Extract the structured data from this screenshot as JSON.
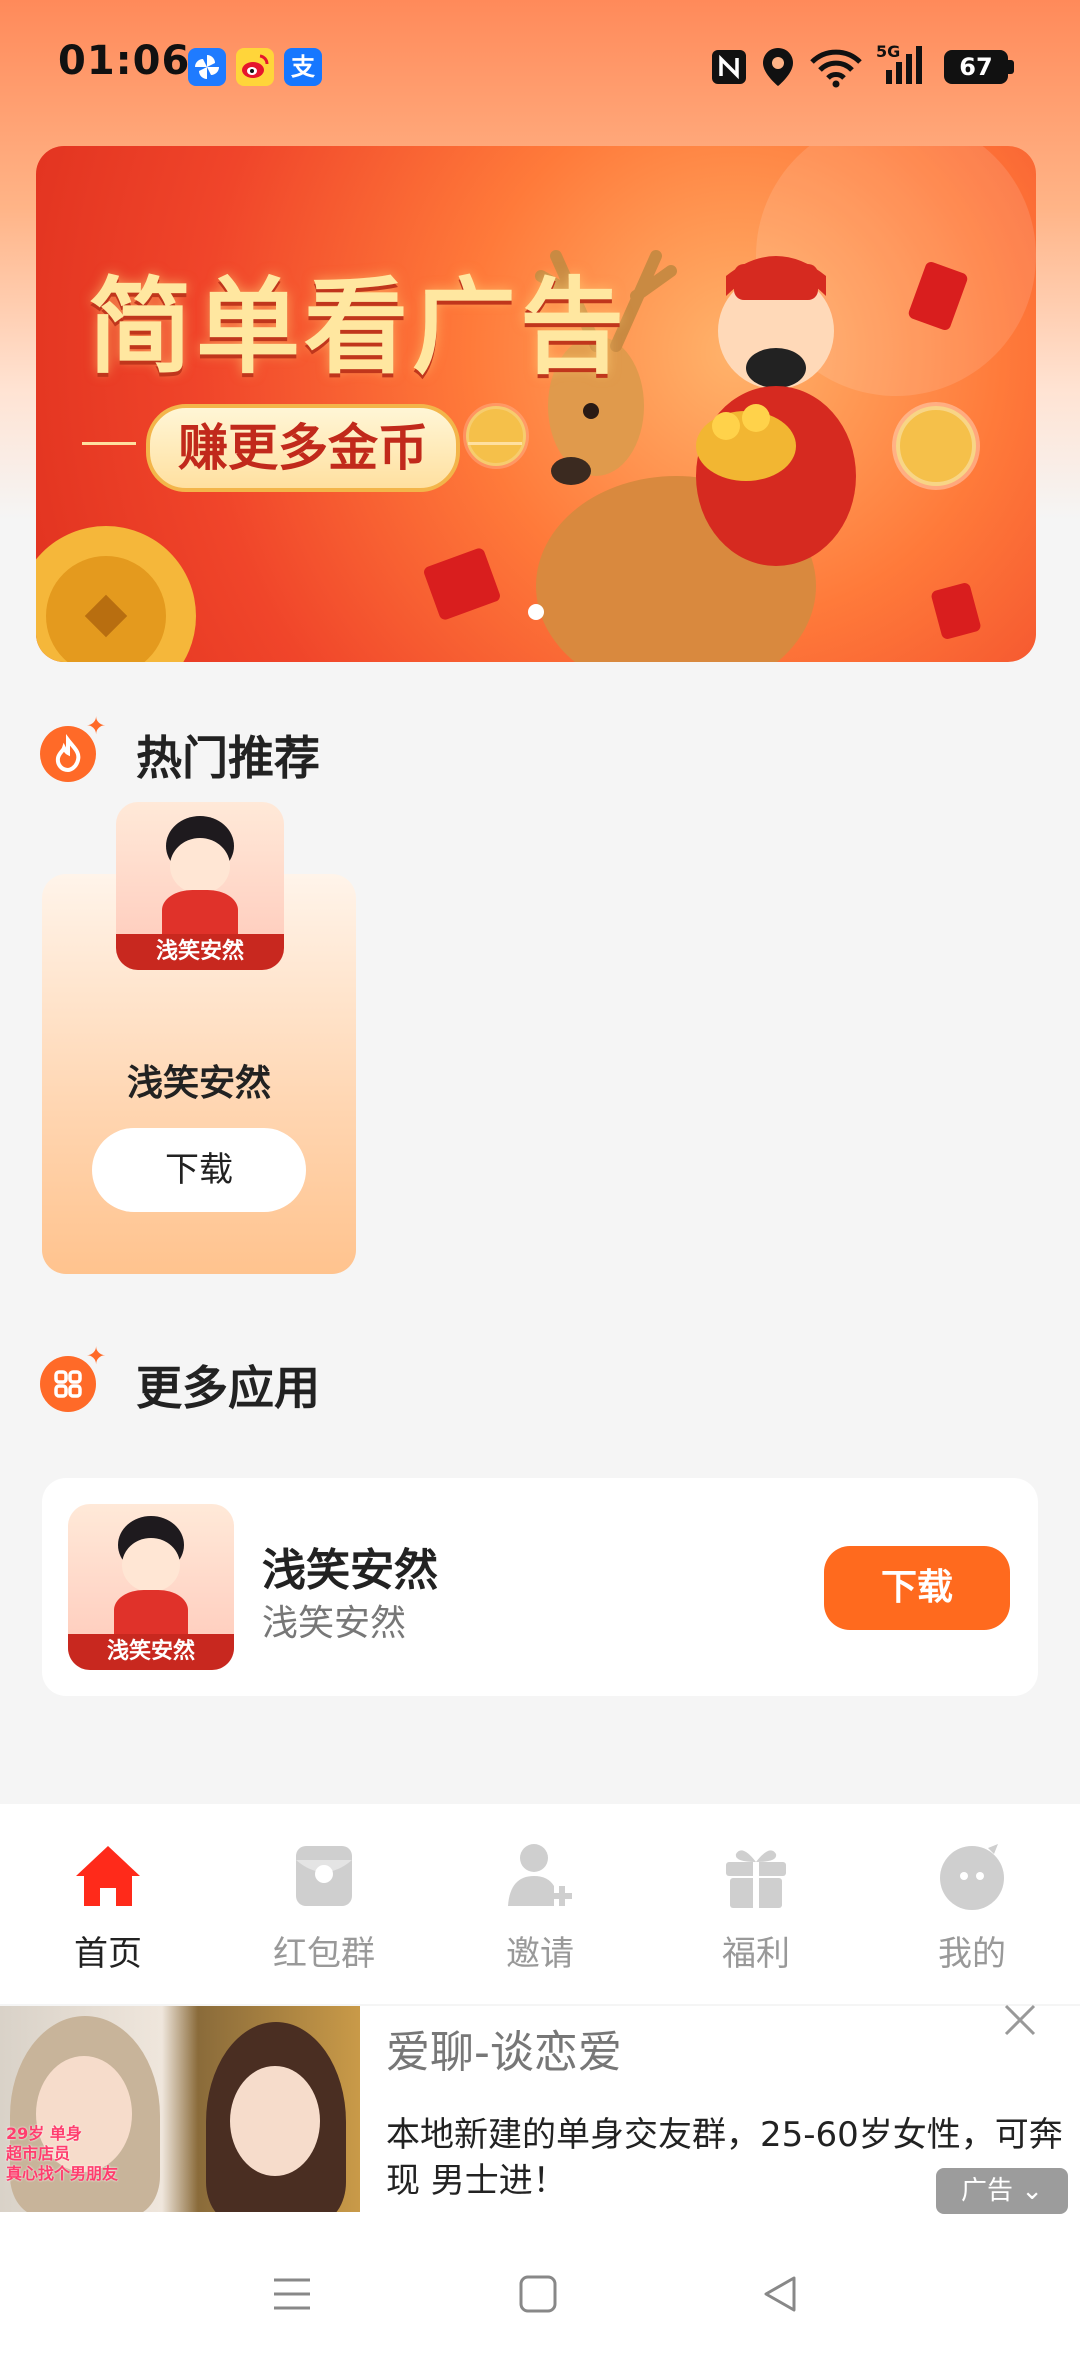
{
  "status_bar": {
    "time": "01:06",
    "battery": "67",
    "app_icons": [
      "pinwheel-app-icon",
      "weibo-app-icon",
      "alipay-app-icon"
    ],
    "alipay_glyph": "支",
    "network": "5G",
    "indicators": [
      "nfc-icon",
      "location-icon",
      "wifi-icon",
      "signal-5g-icon"
    ]
  },
  "banner": {
    "title": "简单看广告",
    "subtitle": "赚更多金币",
    "colors": {
      "primary": "#e0311f",
      "gold": "#ffe7a0"
    }
  },
  "hot_section": {
    "title": "热门推荐",
    "card": {
      "thumb_label": "浅笑安然",
      "name": "浅笑安然",
      "button": "下载"
    }
  },
  "more_section": {
    "title": "更多应用",
    "item": {
      "thumb_label": "浅笑安然",
      "name": "浅笑安然",
      "subtitle": "浅笑安然",
      "button": "下载"
    }
  },
  "bottom_nav": {
    "items": [
      {
        "label": "首页",
        "icon": "home-icon",
        "active": true
      },
      {
        "label": "红包群",
        "icon": "red-packet-icon",
        "active": false
      },
      {
        "label": "邀请",
        "icon": "invite-user-icon",
        "active": false
      },
      {
        "label": "福利",
        "icon": "gift-icon",
        "active": false
      },
      {
        "label": "我的",
        "icon": "profile-icon",
        "active": false
      }
    ],
    "active_color": "#ff2a1a"
  },
  "ad": {
    "title": "爱聊-谈恋爱",
    "description": "本地新建的单身交友群，25-60岁女性，可奔现 男士进！",
    "badge": "广告",
    "image_caption": [
      "29岁 单身",
      "超市店员",
      "真心找个男朋友"
    ]
  },
  "accent_color": "#ff6a1e"
}
